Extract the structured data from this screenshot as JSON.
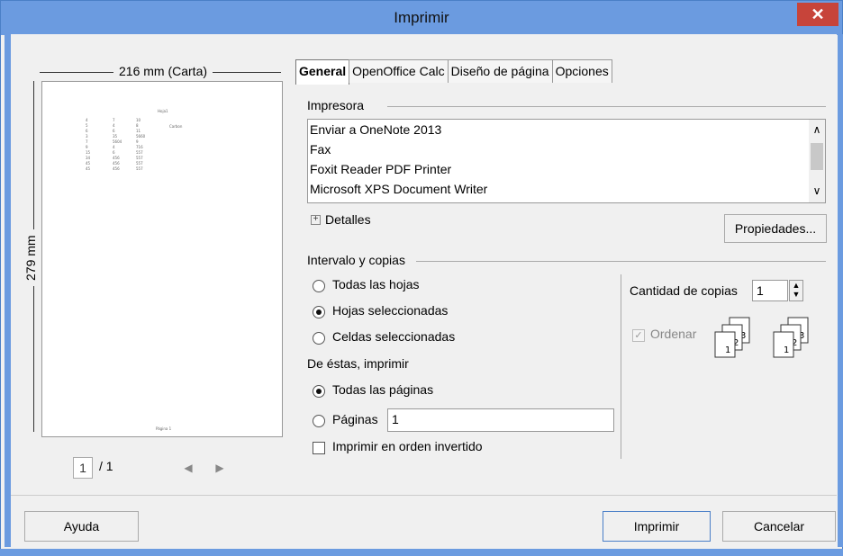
{
  "window": {
    "title": "Imprimir",
    "close_icon": "close-icon"
  },
  "preview": {
    "width_label": "216 mm (Carta)",
    "height_label": "279 mm",
    "current_page": "1",
    "total_pages": "/ 1",
    "mini_header": "Hoja1",
    "mini_label": "Carbon",
    "mini_footer": "Página 1",
    "mini_col1": [
      "4",
      "5",
      "6",
      "3",
      "7",
      "9",
      "15",
      "34",
      "45",
      "45"
    ],
    "mini_col2": [
      "7",
      "4",
      "6",
      "35",
      "5604",
      "4",
      "6",
      "456",
      "456",
      "456"
    ],
    "mini_col3": [
      "10",
      "8",
      "11",
      "5660",
      "9",
      "716",
      "557",
      "557",
      "557",
      "557"
    ]
  },
  "tabs": [
    "General",
    "OpenOffice Calc",
    "Diseño de página",
    "Opciones"
  ],
  "printer": {
    "section_label": "Impresora",
    "items": [
      "Enviar a OneNote 2013",
      "Fax",
      "Foxit Reader PDF Printer",
      "Microsoft XPS Document Writer"
    ],
    "details_label": "Detalles",
    "properties_button": "Propiedades..."
  },
  "range": {
    "section_label": "Intervalo y copias",
    "options": [
      "Todas las hojas",
      "Hojas seleccionadas",
      "Celdas seleccionadas"
    ],
    "selected_option": "Hojas seleccionadas",
    "from_these_label": "De éstas, imprimir",
    "all_pages_label": "Todas las páginas",
    "pages_label": "Páginas",
    "pages_value": "1",
    "reverse_label": "Imprimir en orden invertido",
    "copies_label": "Cantidad de copias",
    "copies_value": "1",
    "collate_label": "Ordenar"
  },
  "buttons": {
    "help": "Ayuda",
    "print": "Imprimir",
    "cancel": "Cancelar"
  },
  "colors": {
    "titlebar": "#6b9be0",
    "close": "#c7443a",
    "window_bg": "#f0f0f0"
  }
}
